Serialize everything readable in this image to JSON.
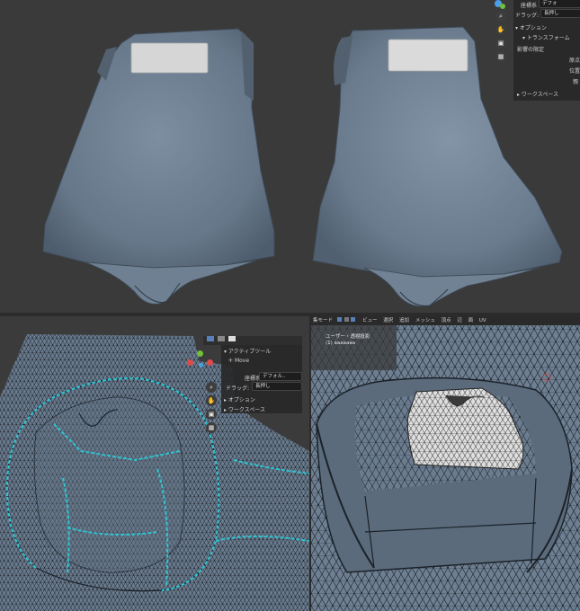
{
  "top_panel": {
    "coord_label": "座標系",
    "coord_value": "デフォ",
    "drag_label": "ドラッグ:",
    "drag_value": "長押し",
    "options_label": "オプション",
    "transform_label": "トランスフォーム",
    "affect_label": "影響の限定",
    "side_labels": [
      "原点",
      "位置",
      "親"
    ],
    "workspace_label": "ワークスペース"
  },
  "bottom_left_panel": {
    "active_tool_label": "アクティブツール",
    "move_label": "Move",
    "coord_label": "座標系",
    "coord_value": "デフォル..",
    "drag_label": "ドラッグ:",
    "drag_value": "長押し",
    "options_label": "オプション",
    "workspace_label": "ワークスペース"
  },
  "bottom_right_header": {
    "mode_label": "集モード",
    "menus": [
      "ビュー",
      "選択",
      "追加",
      "メッシュ",
      "頂点",
      "辺",
      "面",
      "UV"
    ]
  },
  "bottom_right_overlay": {
    "view_label": "ユーザー・透視投影",
    "object_label": "(1) aaaaaaa"
  },
  "colors": {
    "background": "#393939",
    "mesh": "#6b7c8f",
    "seam": "#2ec4d2",
    "selected_face": "#d9d9d9"
  },
  "icons": [
    "gizmo-icon",
    "zoom-icon",
    "hand-icon",
    "camera-icon",
    "grid-icon"
  ]
}
